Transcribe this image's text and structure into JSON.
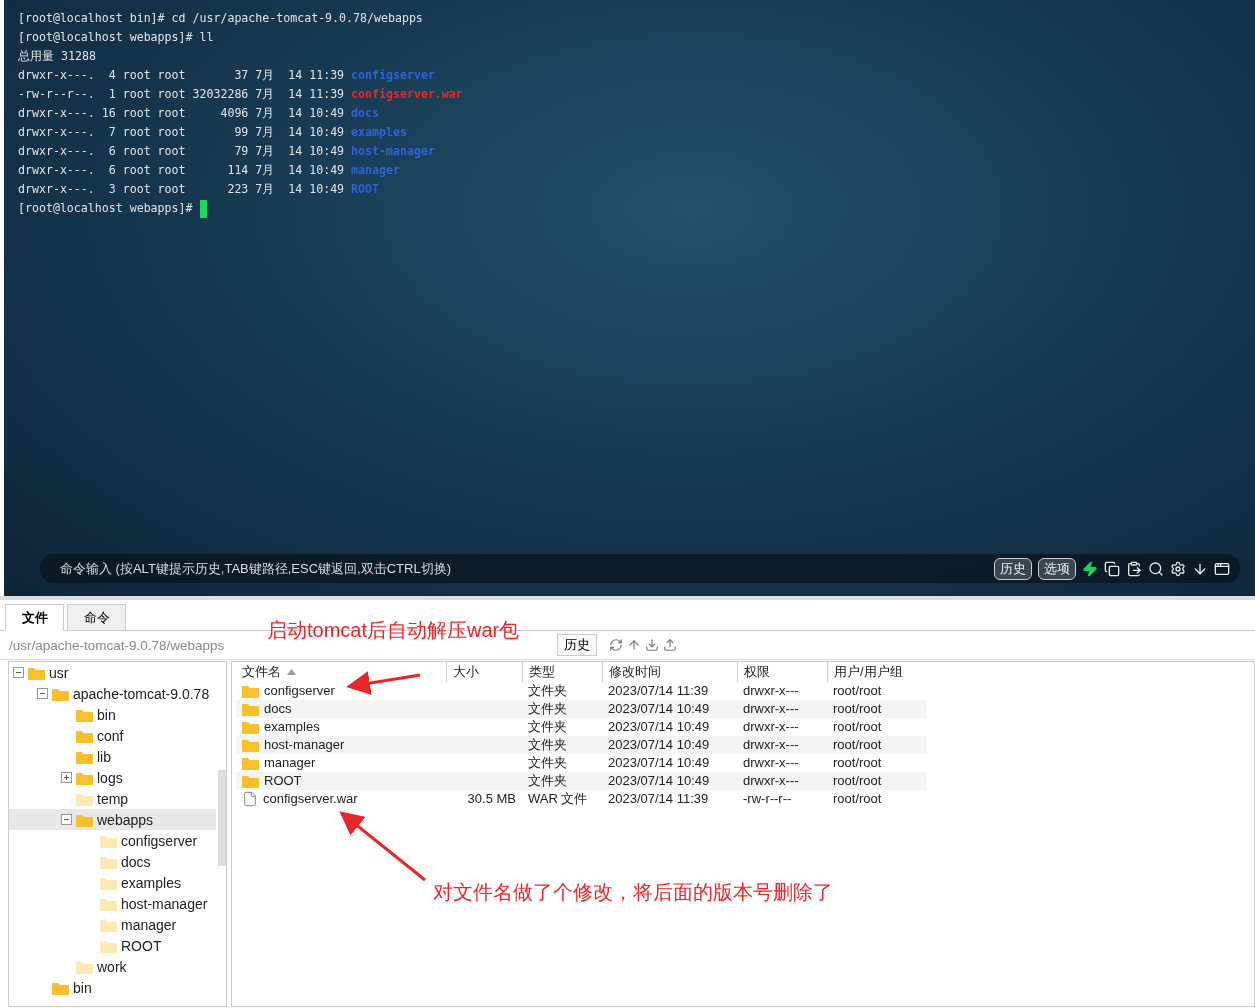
{
  "terminal": {
    "lines": [
      {
        "kind": "text",
        "text": "[root@localhost bin]# cd /usr/apache-tomcat-9.0.78/webapps"
      },
      {
        "kind": "text",
        "text": "[root@localhost webapps]# ll"
      },
      {
        "kind": "text",
        "text": "总用量 31288"
      },
      {
        "kind": "entry",
        "prefix": "drwxr-x---.  4 root root       37 7月  14 11:39",
        "name": "configserver",
        "color": "#2f62d6"
      },
      {
        "kind": "entry",
        "prefix": "-rw-r--r--.  1 root root 32032286 7月  14 11:39",
        "name": "configserver.war",
        "color": "#e8262a"
      },
      {
        "kind": "entry",
        "prefix": "drwxr-x---. 16 root root     4096 7月  14 10:49",
        "name": "docs",
        "color": "#2f62d6"
      },
      {
        "kind": "entry",
        "prefix": "drwxr-x---.  7 root root       99 7月  14 10:49",
        "name": "examples",
        "color": "#2f62d6"
      },
      {
        "kind": "entry",
        "prefix": "drwxr-x---.  6 root root       79 7月  14 10:49",
        "name": "host-manager",
        "color": "#2f62d6"
      },
      {
        "kind": "entry",
        "prefix": "drwxr-x---.  6 root root      114 7月  14 10:49",
        "name": "manager",
        "color": "#2f62d6"
      },
      {
        "kind": "entry",
        "prefix": "drwxr-x---.  3 root root      223 7月  14 10:49",
        "name": "ROOT",
        "color": "#2f62d6"
      },
      {
        "kind": "prompt",
        "text": "[root@localhost webapps]#"
      }
    ]
  },
  "command_bar": {
    "placeholder": "命令输入 (按ALT键提示历史,TAB键路径,ESC键返回,双击CTRL切换)",
    "buttons": [
      "历史",
      "选项"
    ]
  },
  "tabs": [
    {
      "label": "文件",
      "selected": true
    },
    {
      "label": "命令",
      "selected": false
    }
  ],
  "path_bar": {
    "path": "/usr/apache-tomcat-9.0.78/webapps",
    "history_button": "历史"
  },
  "tree": [
    {
      "label": "usr",
      "expanded": true,
      "selected": false,
      "faded": false,
      "children": [
        {
          "label": "apache-tomcat-9.0.78",
          "expanded": true,
          "selected": false,
          "faded": false,
          "children": [
            {
              "label": "bin",
              "selected": false,
              "faded": false
            },
            {
              "label": "conf",
              "selected": false,
              "faded": false
            },
            {
              "label": "lib",
              "selected": false,
              "faded": false
            },
            {
              "label": "logs",
              "expanded": false,
              "selected": false,
              "faded": false
            },
            {
              "label": "temp",
              "selected": false,
              "faded": true
            },
            {
              "label": "webapps",
              "expanded": true,
              "selected": true,
              "faded": false,
              "children": [
                {
                  "label": "configserver",
                  "selected": false,
                  "faded": true
                },
                {
                  "label": "docs",
                  "selected": false,
                  "faded": true
                },
                {
                  "label": "examples",
                  "selected": false,
                  "faded": true
                },
                {
                  "label": "host-manager",
                  "selected": false,
                  "faded": true
                },
                {
                  "label": "manager",
                  "selected": false,
                  "faded": true
                },
                {
                  "label": "ROOT",
                  "selected": false,
                  "faded": true
                }
              ]
            },
            {
              "label": "work",
              "selected": false,
              "faded": true
            }
          ]
        },
        {
          "label": "bin",
          "selected": false,
          "faded": false
        }
      ]
    }
  ],
  "table": {
    "columns": [
      "文件名",
      "大小",
      "类型",
      "修改时间",
      "权限",
      "用户/用户组"
    ],
    "rows": [
      {
        "kind": "folder",
        "name": "configserver",
        "type": "文件夹",
        "modified": "2023/07/14 11:39",
        "permissions": "drwxr-x---",
        "owner": "root/root"
      },
      {
        "kind": "folder",
        "name": "docs",
        "type": "文件夹",
        "modified": "2023/07/14 10:49",
        "permissions": "drwxr-x---",
        "owner": "root/root"
      },
      {
        "kind": "folder",
        "name": "examples",
        "type": "文件夹",
        "modified": "2023/07/14 10:49",
        "permissions": "drwxr-x---",
        "owner": "root/root"
      },
      {
        "kind": "folder",
        "name": "host-manager",
        "type": "文件夹",
        "modified": "2023/07/14 10:49",
        "permissions": "drwxr-x---",
        "owner": "root/root"
      },
      {
        "kind": "folder",
        "name": "manager",
        "type": "文件夹",
        "modified": "2023/07/14 10:49",
        "permissions": "drwxr-x---",
        "owner": "root/root"
      },
      {
        "kind": "folder",
        "name": "ROOT",
        "type": "文件夹",
        "modified": "2023/07/14 10:49",
        "permissions": "drwxr-x---",
        "owner": "root/root"
      },
      {
        "kind": "file",
        "name": "configserver.war",
        "size": "30.5 MB",
        "type": "WAR 文件",
        "modified": "2023/07/14 11:39",
        "permissions": "-rw-r--r--",
        "owner": "root/root"
      }
    ]
  },
  "annotations": [
    "启动tomcat后自动解压war包",
    "对文件名做了个修改，将后面的版本号删除了"
  ]
}
